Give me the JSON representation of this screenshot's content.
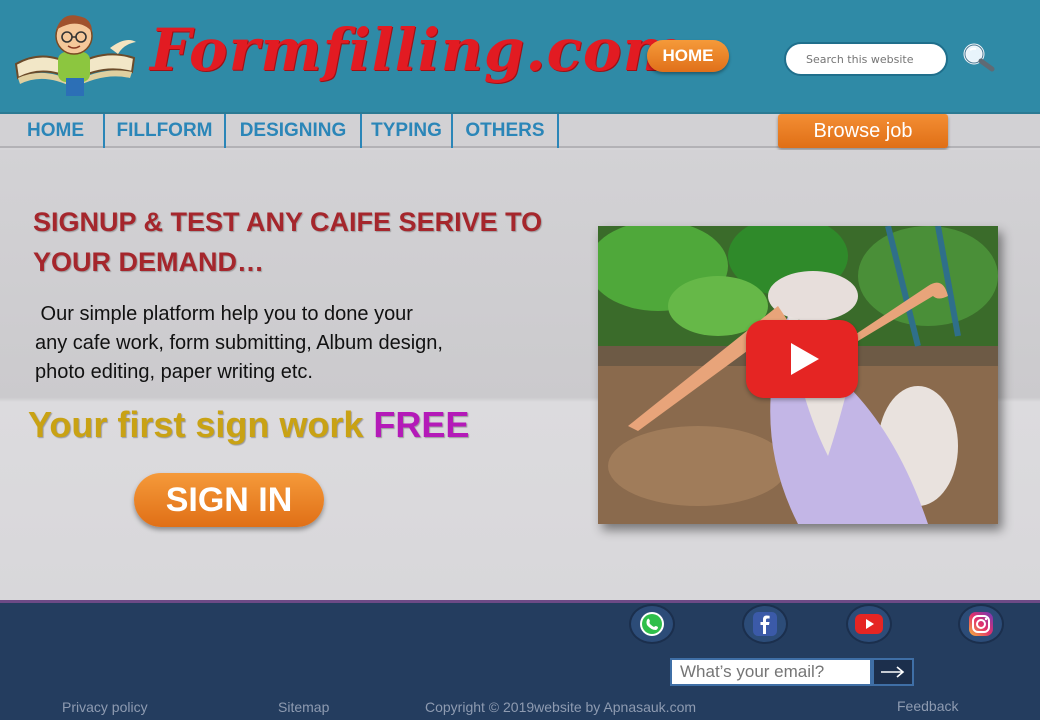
{
  "header": {
    "logo_text": "Formfilling.com",
    "home_label": "HOME",
    "search_placeholder": "Search this website"
  },
  "nav": {
    "items": [
      {
        "label": "HOME"
      },
      {
        "label": "FILLFORM"
      },
      {
        "label": "DESIGNING"
      },
      {
        "label": "TYPING"
      },
      {
        "label": "OTHERS"
      }
    ],
    "browse_label": "Browse job"
  },
  "hero": {
    "headline": "SIGNUP & TEST ANY CAIFE SERIVE TO YOUR DEMAND…",
    "description_line1": " Our simple platform help you to done your",
    "description_line2": "any cafe work, form submitting, Album design,",
    "description_line3": "photo editing, paper writing etc.",
    "promo_prefix": "Your first sign work ",
    "promo_highlight": "FREE",
    "signin_label": "SIGN IN"
  },
  "footer": {
    "social": [
      {
        "icon": "whatsapp-icon"
      },
      {
        "icon": "facebook-icon"
      },
      {
        "icon": "youtube-icon"
      },
      {
        "icon": "instagram-icon"
      }
    ],
    "email_placeholder": "What’s your email?",
    "links": {
      "privacy": "Privacy policy",
      "sitemap": "Sitemap",
      "copyright": "Copyright © 2019website by Apnasauk.com",
      "feedback": "Feedback"
    }
  },
  "colors": {
    "header_bg": "#2f8aa6",
    "logo_red": "#e21b22",
    "accent_orange": "#ee8329",
    "nav_text": "#2b86b8",
    "footer_bg": "#243d5f",
    "headline_red": "#a5262c",
    "promo_gold": "#c9a214",
    "promo_purple": "#b41ab8"
  }
}
